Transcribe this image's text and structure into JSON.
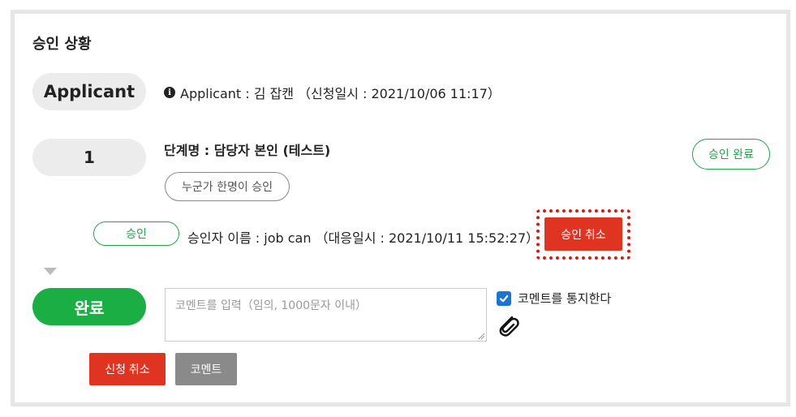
{
  "section": {
    "title": "승인 상황"
  },
  "applicant": {
    "pill_label": "Applicant",
    "info": "Applicant : 김 잡캔 （신청일시 : 2021/10/06 11:17）"
  },
  "step": {
    "number": "1",
    "name": "단계명 : 담당자 본인 (테스트)",
    "rule": "누군가 한명이 승인",
    "status": "승인 완료"
  },
  "approval": {
    "badge": "승인",
    "approver": "승인자 이름 : job can （대응일시 : 2021/10/11 15:52:27）",
    "cancel_button": "승인 취소"
  },
  "final": {
    "pill_label": "완료",
    "comment_placeholder": "코멘트를 입력（임의, 1000문자 이내）",
    "notify_label": "코멘트를 통지한다",
    "notify_checked": true
  },
  "buttons": {
    "cancel_request": "신청 취소",
    "comment": "코멘트"
  },
  "colors": {
    "green": "#1aae45",
    "red": "#e03423",
    "gray": "#8a8a8a",
    "checkbox_blue": "#1b75d0",
    "highlight_dotted": "#d21b1b"
  },
  "icons": [
    "info-icon",
    "checkbox-check-icon",
    "paperclip-icon",
    "collapse-triangle-icon"
  ]
}
